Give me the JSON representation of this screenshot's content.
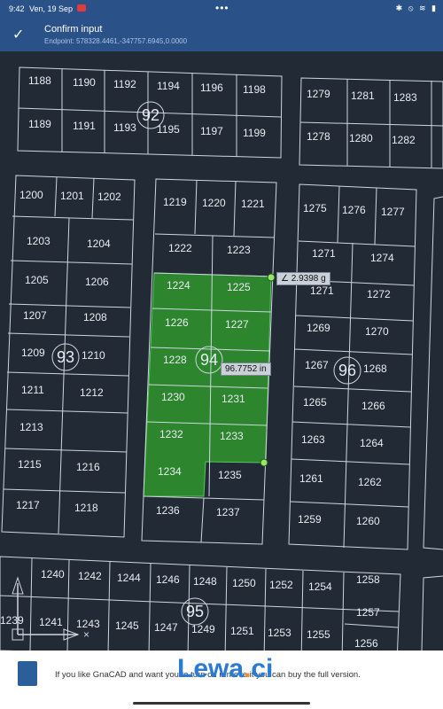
{
  "status": {
    "time": "9:42",
    "date": "Ven, 19 Sep",
    "dots": "•••",
    "right_icons": "✱ ⦸ ≋ ▮"
  },
  "confirm": {
    "title": "Confirm input",
    "subtitle": "Endpoint: 578328.4461,-347757.6945,0.0000"
  },
  "measure": {
    "angle": "∠ 2.9398 g",
    "length": "96.7752 in"
  },
  "lots": [
    "1188",
    "1190",
    "1192",
    "1194",
    "1196",
    "1198",
    "1189",
    "1191",
    "1193",
    "1195",
    "1197",
    "1199",
    "1279",
    "1281",
    "1283",
    "1278",
    "1280",
    "1282",
    "1200",
    "1201",
    "1202",
    "1203",
    "1204",
    "1205",
    "1206",
    "1207",
    "1208",
    "1209",
    "1210",
    "1211",
    "1212",
    "1213",
    "1215",
    "1216",
    "1217",
    "1218",
    "1219",
    "1220",
    "1221",
    "1222",
    "1223",
    "1224",
    "1225",
    "1226",
    "1227",
    "1228",
    "1230",
    "1231",
    "1232",
    "1233",
    "1234",
    "1235",
    "1236",
    "1237",
    "1275",
    "1276",
    "1277",
    "1271",
    "1274",
    "1271",
    "1272",
    "1269",
    "1270",
    "1267",
    "1268",
    "1265",
    "1266",
    "1263",
    "1264",
    "1261",
    "1262",
    "1259",
    "1260",
    "1240",
    "1242",
    "1244",
    "1246",
    "1248",
    "1250",
    "1252",
    "1254",
    "1258",
    "1257",
    "1256",
    "1239",
    "1241",
    "1243",
    "1245",
    "1247",
    "1249",
    "1251",
    "1253",
    "1255"
  ],
  "blocks": [
    "92",
    "93",
    "94",
    "95",
    "96"
  ],
  "banner": {
    "text": "If you like GnaCAD and want you to turn on remove it you can buy the full version.",
    "logo_main": "Lewa",
    "logo_dot": ".",
    "logo_tail": "ci"
  },
  "colors": {
    "background": "#222a36",
    "selection": "#2e8b2e",
    "header": "#2b5288"
  }
}
